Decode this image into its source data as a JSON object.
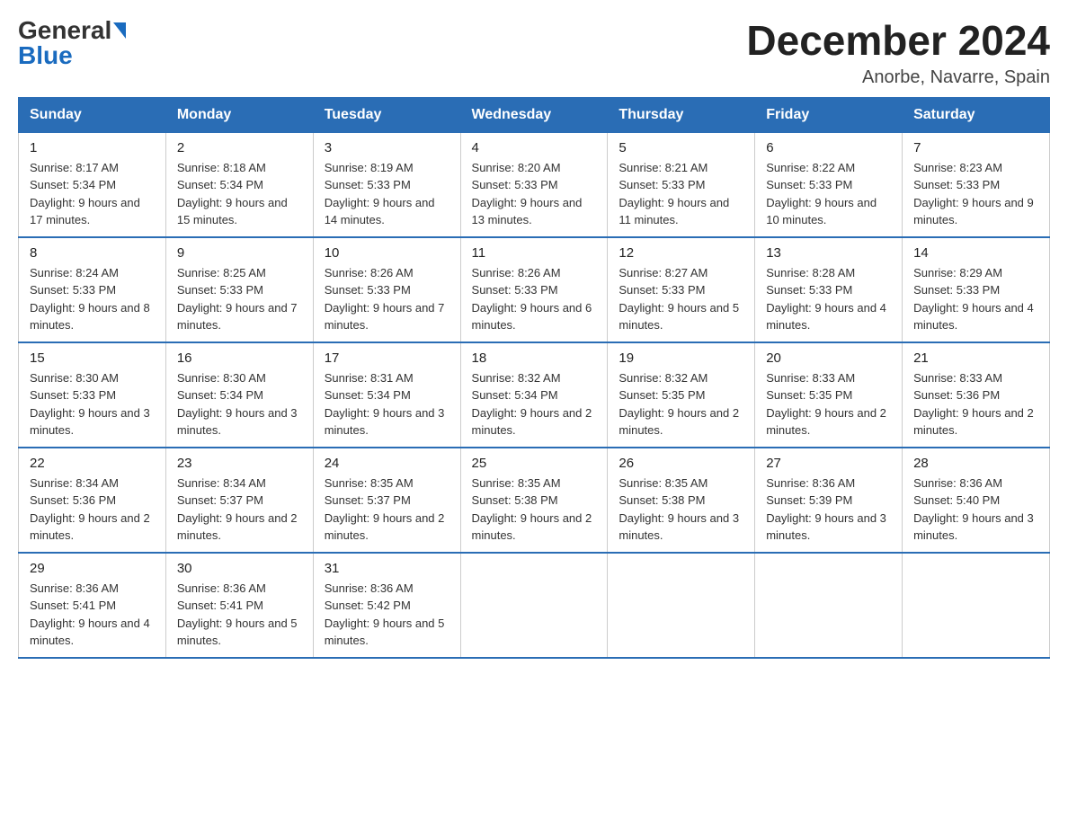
{
  "logo": {
    "general": "General",
    "blue": "Blue"
  },
  "title": "December 2024",
  "location": "Anorbe, Navarre, Spain",
  "days_of_week": [
    "Sunday",
    "Monday",
    "Tuesday",
    "Wednesday",
    "Thursday",
    "Friday",
    "Saturday"
  ],
  "weeks": [
    [
      {
        "day": "1",
        "sunrise": "8:17 AM",
        "sunset": "5:34 PM",
        "daylight": "9 hours and 17 minutes."
      },
      {
        "day": "2",
        "sunrise": "8:18 AM",
        "sunset": "5:34 PM",
        "daylight": "9 hours and 15 minutes."
      },
      {
        "day": "3",
        "sunrise": "8:19 AM",
        "sunset": "5:33 PM",
        "daylight": "9 hours and 14 minutes."
      },
      {
        "day": "4",
        "sunrise": "8:20 AM",
        "sunset": "5:33 PM",
        "daylight": "9 hours and 13 minutes."
      },
      {
        "day": "5",
        "sunrise": "8:21 AM",
        "sunset": "5:33 PM",
        "daylight": "9 hours and 11 minutes."
      },
      {
        "day": "6",
        "sunrise": "8:22 AM",
        "sunset": "5:33 PM",
        "daylight": "9 hours and 10 minutes."
      },
      {
        "day": "7",
        "sunrise": "8:23 AM",
        "sunset": "5:33 PM",
        "daylight": "9 hours and 9 minutes."
      }
    ],
    [
      {
        "day": "8",
        "sunrise": "8:24 AM",
        "sunset": "5:33 PM",
        "daylight": "9 hours and 8 minutes."
      },
      {
        "day": "9",
        "sunrise": "8:25 AM",
        "sunset": "5:33 PM",
        "daylight": "9 hours and 7 minutes."
      },
      {
        "day": "10",
        "sunrise": "8:26 AM",
        "sunset": "5:33 PM",
        "daylight": "9 hours and 7 minutes."
      },
      {
        "day": "11",
        "sunrise": "8:26 AM",
        "sunset": "5:33 PM",
        "daylight": "9 hours and 6 minutes."
      },
      {
        "day": "12",
        "sunrise": "8:27 AM",
        "sunset": "5:33 PM",
        "daylight": "9 hours and 5 minutes."
      },
      {
        "day": "13",
        "sunrise": "8:28 AM",
        "sunset": "5:33 PM",
        "daylight": "9 hours and 4 minutes."
      },
      {
        "day": "14",
        "sunrise": "8:29 AM",
        "sunset": "5:33 PM",
        "daylight": "9 hours and 4 minutes."
      }
    ],
    [
      {
        "day": "15",
        "sunrise": "8:30 AM",
        "sunset": "5:33 PM",
        "daylight": "9 hours and 3 minutes."
      },
      {
        "day": "16",
        "sunrise": "8:30 AM",
        "sunset": "5:34 PM",
        "daylight": "9 hours and 3 minutes."
      },
      {
        "day": "17",
        "sunrise": "8:31 AM",
        "sunset": "5:34 PM",
        "daylight": "9 hours and 3 minutes."
      },
      {
        "day": "18",
        "sunrise": "8:32 AM",
        "sunset": "5:34 PM",
        "daylight": "9 hours and 2 minutes."
      },
      {
        "day": "19",
        "sunrise": "8:32 AM",
        "sunset": "5:35 PM",
        "daylight": "9 hours and 2 minutes."
      },
      {
        "day": "20",
        "sunrise": "8:33 AM",
        "sunset": "5:35 PM",
        "daylight": "9 hours and 2 minutes."
      },
      {
        "day": "21",
        "sunrise": "8:33 AM",
        "sunset": "5:36 PM",
        "daylight": "9 hours and 2 minutes."
      }
    ],
    [
      {
        "day": "22",
        "sunrise": "8:34 AM",
        "sunset": "5:36 PM",
        "daylight": "9 hours and 2 minutes."
      },
      {
        "day": "23",
        "sunrise": "8:34 AM",
        "sunset": "5:37 PM",
        "daylight": "9 hours and 2 minutes."
      },
      {
        "day": "24",
        "sunrise": "8:35 AM",
        "sunset": "5:37 PM",
        "daylight": "9 hours and 2 minutes."
      },
      {
        "day": "25",
        "sunrise": "8:35 AM",
        "sunset": "5:38 PM",
        "daylight": "9 hours and 2 minutes."
      },
      {
        "day": "26",
        "sunrise": "8:35 AM",
        "sunset": "5:38 PM",
        "daylight": "9 hours and 3 minutes."
      },
      {
        "day": "27",
        "sunrise": "8:36 AM",
        "sunset": "5:39 PM",
        "daylight": "9 hours and 3 minutes."
      },
      {
        "day": "28",
        "sunrise": "8:36 AM",
        "sunset": "5:40 PM",
        "daylight": "9 hours and 3 minutes."
      }
    ],
    [
      {
        "day": "29",
        "sunrise": "8:36 AM",
        "sunset": "5:41 PM",
        "daylight": "9 hours and 4 minutes."
      },
      {
        "day": "30",
        "sunrise": "8:36 AM",
        "sunset": "5:41 PM",
        "daylight": "9 hours and 5 minutes."
      },
      {
        "day": "31",
        "sunrise": "8:36 AM",
        "sunset": "5:42 PM",
        "daylight": "9 hours and 5 minutes."
      },
      null,
      null,
      null,
      null
    ]
  ],
  "labels": {
    "sunrise_prefix": "Sunrise: ",
    "sunset_prefix": "Sunset: ",
    "daylight_prefix": "Daylight: "
  }
}
